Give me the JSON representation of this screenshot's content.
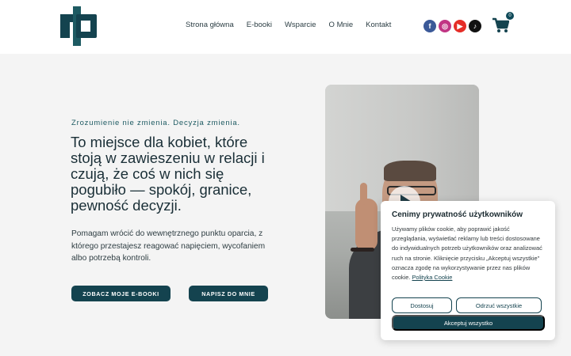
{
  "header": {
    "nav": [
      "Strona główna",
      "E-booki",
      "Wsparcie",
      "O Mnie",
      "Kontakt"
    ],
    "socials": [
      {
        "icon": "facebook-icon",
        "color": "#3b5998",
        "glyph": "f"
      },
      {
        "icon": "instagram-icon",
        "color": "#c13584",
        "glyph": "◎"
      },
      {
        "icon": "youtube-icon",
        "color": "#e52d27",
        "glyph": "▶"
      },
      {
        "icon": "tiktok-icon",
        "color": "#111111",
        "glyph": "♪"
      }
    ],
    "cart_count": "0"
  },
  "hero": {
    "tagline": "Zrozumienie nie zmienia. Decyzja zmienia.",
    "headline": "To miejsce dla kobiet, które stoją w zawieszeniu w relacji i czują, że coś w nich się pogubiło — spokój, granice, pewność decyzji.",
    "body": "Pomagam wrócić do wewnętrznego punktu oparcia, z którego przestajesz reagować napięciem, wycofaniem albo potrzebą kontroli.",
    "btn_ebooks": "ZOBACZ MOJE E-BOOKI",
    "btn_write": "NAPISZ DO MNIE"
  },
  "cookie": {
    "title": "Cenimy prywatność użytkowników",
    "text": "Używamy plików cookie, aby poprawić jakość przeglądania, wyświetlać reklamy lub treści dostosowane do indywidualnych potrzeb użytkowników oraz analizować ruch na stronie. Kliknięcie przycisku „Akceptuj wszystkie\" oznacza zgodę na wykorzystywanie przez nas plików cookie.",
    "link": "Polityka Cookie",
    "btn_custom": "Dostosuj",
    "btn_reject": "Odrzuć wszystkie",
    "btn_accept": "Akceptuj wszystko"
  },
  "colors": {
    "brand": "#14434f",
    "background": "#f4f4f4"
  }
}
